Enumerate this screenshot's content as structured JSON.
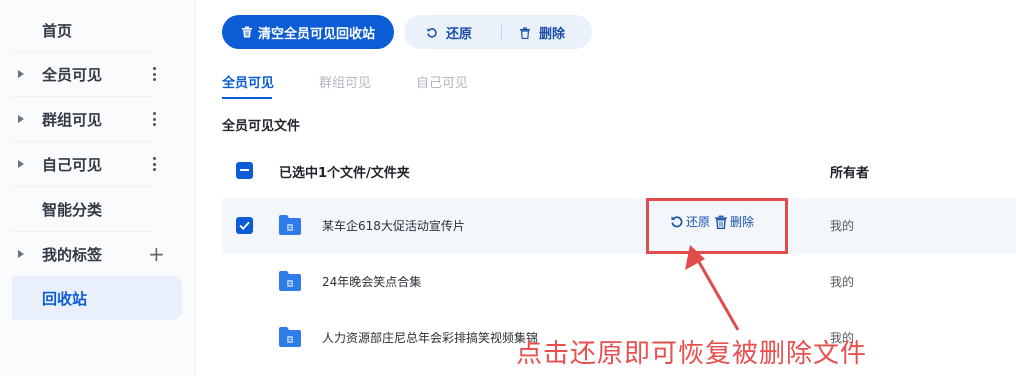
{
  "sidebar": {
    "items": [
      {
        "label": "首页"
      },
      {
        "label": "全员可见"
      },
      {
        "label": "群组可见"
      },
      {
        "label": "自己可见"
      },
      {
        "label": "智能分类"
      },
      {
        "label": "我的标签"
      },
      {
        "label": "回收站"
      }
    ],
    "active": "回收站"
  },
  "toolbar": {
    "clear_label": "清空全员可见回收站",
    "restore_label": "还原",
    "delete_label": "删除"
  },
  "tabs": [
    {
      "label": "全员可见",
      "active": true
    },
    {
      "label": "群组可见",
      "active": false
    },
    {
      "label": "自己可见",
      "active": false
    }
  ],
  "section_title": "全员可见文件",
  "table": {
    "header_selection_label": "已选中1个文件/文件夹",
    "header_owner": "所有者",
    "rows": [
      {
        "name": "某车企618大促活动宣传片",
        "owner": "我的",
        "selected": true
      },
      {
        "name": "24年晚会笑点合集",
        "owner": "我的",
        "selected": false
      },
      {
        "name": "人力资源部庄尼总年会彩排搞笑视频集锦",
        "owner": "我的",
        "selected": false
      }
    ],
    "row_actions": {
      "restore": "还原",
      "delete": "删除"
    }
  },
  "annotation": {
    "text": "点击还原即可恢复被删除文件"
  },
  "colors": {
    "accent": "#0b5cd5",
    "annotation": "#e04b4b",
    "folder": "#2f7bea"
  }
}
